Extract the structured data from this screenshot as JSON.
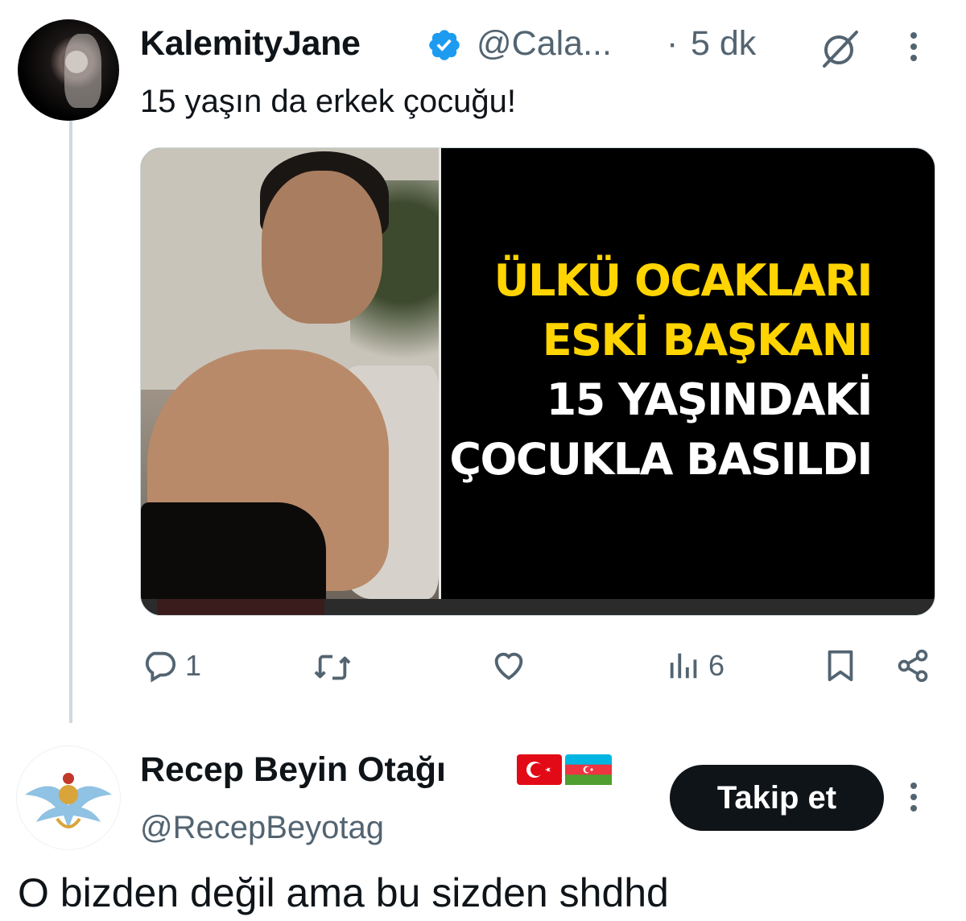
{
  "tweet": {
    "author_name": "KalemityJane",
    "handle": "@Cala...",
    "separator": "·",
    "time": "5 dk",
    "text": "15 yaşın da erkek çocuğu!",
    "media": {
      "headline_line1": "ÜLKÜ OCAKLARI",
      "headline_line2": "ESKİ BAŞKANI",
      "headline_line3": "15 YAŞINDAKİ",
      "headline_line4": "ÇOCUKLA BASILDI",
      "video_progress_fraction": 0.22
    },
    "actions": {
      "reply_count": "1",
      "views_count": "6"
    },
    "colors": {
      "accent": "#1d9bf0",
      "headline_yellow": "#ffd400",
      "muted": "#536471"
    }
  },
  "reply": {
    "author_name": "Recep Beyin Otağı",
    "handle": "@RecepBeyotag",
    "follow_label": "Takip et",
    "text": "O bizden değil ama bu sizden shdhd"
  }
}
